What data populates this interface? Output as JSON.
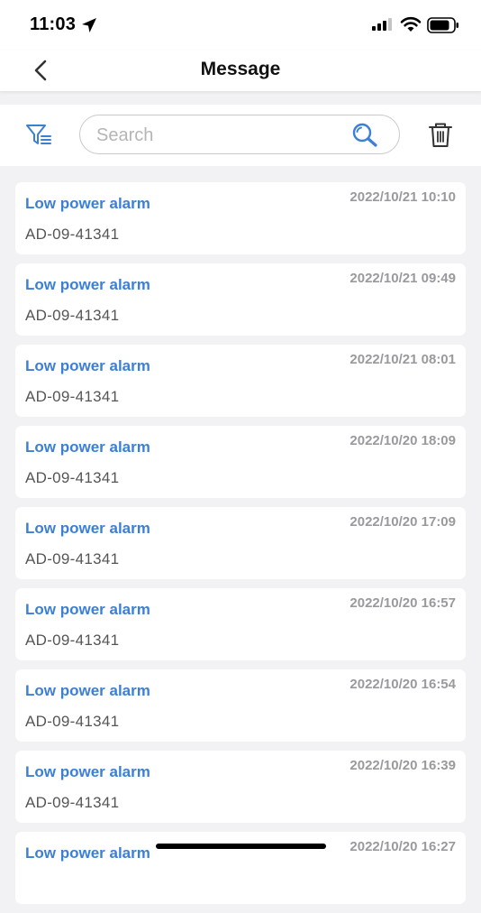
{
  "status_bar": {
    "time": "11:03"
  },
  "nav": {
    "title": "Message"
  },
  "toolbar": {
    "search_placeholder": "Search",
    "search_value": ""
  },
  "messages": [
    {
      "title": "Low power alarm",
      "time": "2022/10/21 10:10",
      "device": "AD-09-41341"
    },
    {
      "title": "Low power alarm",
      "time": "2022/10/21 09:49",
      "device": "AD-09-41341"
    },
    {
      "title": "Low power alarm",
      "time": "2022/10/21 08:01",
      "device": "AD-09-41341"
    },
    {
      "title": "Low power alarm",
      "time": "2022/10/20 18:09",
      "device": "AD-09-41341"
    },
    {
      "title": "Low power alarm",
      "time": "2022/10/20 17:09",
      "device": "AD-09-41341"
    },
    {
      "title": "Low power alarm",
      "time": "2022/10/20 16:57",
      "device": "AD-09-41341"
    },
    {
      "title": "Low power alarm",
      "time": "2022/10/20 16:54",
      "device": "AD-09-41341"
    },
    {
      "title": "Low power alarm",
      "time": "2022/10/20 16:39",
      "device": "AD-09-41341"
    },
    {
      "title": "Low power alarm",
      "time": "2022/10/20 16:27",
      "device": ""
    }
  ],
  "colors": {
    "accent": "#3b7fd6",
    "background": "#f2f2f4",
    "timestamp": "#9a9a9e"
  },
  "icons": {
    "back": "chevron-left-icon",
    "filter": "filter-icon",
    "search": "search-icon",
    "delete": "trash-icon"
  }
}
